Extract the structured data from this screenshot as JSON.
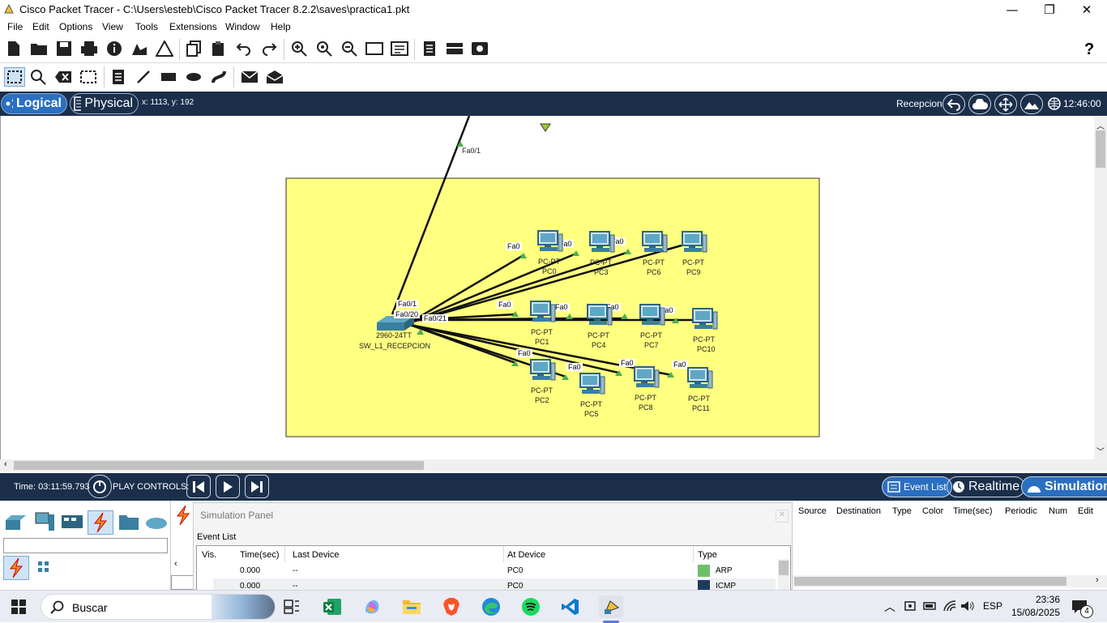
{
  "window": {
    "title": "Cisco Packet Tracer - C:\\Users\\esteb\\Cisco Packet Tracer 8.2.2\\saves\\practica1.pkt",
    "min": "—",
    "max": "❐",
    "close": "✕"
  },
  "menu": [
    "File",
    "Edit",
    "Options",
    "View",
    "Tools",
    "Extensions",
    "Window",
    "Help"
  ],
  "toolbar_main_icons": [
    "new-icon",
    "open-icon",
    "save-icon",
    "print-icon",
    "info-icon",
    "activity-wizard-icon",
    "network-info-icon",
    "copy-icon",
    "paste-icon",
    "undo-icon",
    "redo-icon",
    "zoom-in-icon",
    "zoom-reset-icon",
    "zoom-out-icon",
    "drawing-palette-icon",
    "custom-device-icon",
    "notes-icon",
    "viewport-icon",
    "screenshot-icon"
  ],
  "help_label": "?",
  "logicalbar": {
    "logical": "Logical",
    "physical": "Physical",
    "coords": "x: 1113, y: 192",
    "location": "Recepcion",
    "clock": "12:46:00"
  },
  "topology": {
    "uplink_port": "Fa0/1",
    "switch_model": "2960-24TT",
    "switch_name": "SW_L1_RECEPCION",
    "switch_ports": [
      "Fa0/1",
      "Fa0/20",
      "Fa0/21"
    ],
    "pc_type": "PC-PT",
    "pc_port": "Fa0",
    "pcs": [
      {
        "name": "PC0"
      },
      {
        "name": "PC3"
      },
      {
        "name": "PC6"
      },
      {
        "name": "PC9"
      },
      {
        "name": "PC1"
      },
      {
        "name": "PC4"
      },
      {
        "name": "PC7"
      },
      {
        "name": "PC10"
      },
      {
        "name": "PC2"
      },
      {
        "name": "PC5"
      },
      {
        "name": "PC8"
      },
      {
        "name": "PC11"
      }
    ]
  },
  "simbar": {
    "time": "Time: 03:11:59.793",
    "play_controls": "PLAY CONTROLS:",
    "event_list": "Event List",
    "realtime": "Realtime",
    "simulation": "Simulation"
  },
  "sim_panel": {
    "title": "Simulation Panel",
    "event_list": "Event List",
    "columns": [
      "Vis.",
      "Time(sec)",
      "Last Device",
      "At Device",
      "Type"
    ],
    "rows": [
      {
        "time": "0.000",
        "last": "--",
        "at": "PC0",
        "type": "ARP",
        "color": "#6fbf6a"
      },
      {
        "time": "0.000",
        "last": "--",
        "at": "PC0",
        "type": "ICMP",
        "color": "#1f3a5f"
      }
    ]
  },
  "pdu_columns": [
    "Source",
    "Destination",
    "Type",
    "Color",
    "Time(sec)",
    "Periodic",
    "Num",
    "Edit"
  ],
  "taskbar": {
    "search": "Buscar",
    "lang": "ESP",
    "time": "23:36",
    "date": "15/08/2025",
    "notif": "4"
  }
}
